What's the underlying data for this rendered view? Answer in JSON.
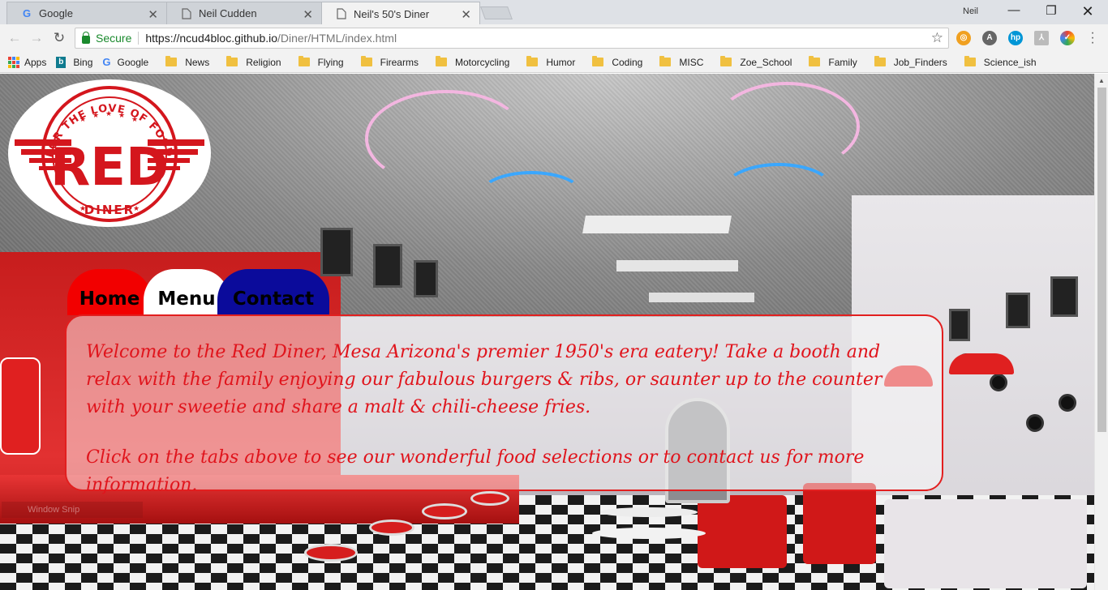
{
  "browser": {
    "tabs": [
      {
        "title": "Google",
        "favicon": "google-g-icon"
      },
      {
        "title": "Neil Cudden",
        "favicon": "document-icon"
      },
      {
        "title": "Neil's 50's Diner",
        "favicon": "document-icon"
      }
    ],
    "profile_name": "Neil",
    "address": {
      "secure_label": "Secure",
      "url_host": "https://ncud4bloc.github.io",
      "url_path": "/Diner/HTML/index.html"
    },
    "bookmarks": [
      {
        "label": "Apps",
        "icon": "apps-grid-icon"
      },
      {
        "label": "Bing",
        "icon": "bing-icon"
      },
      {
        "label": "Google",
        "icon": "google-g-icon"
      },
      {
        "label": "News",
        "icon": "folder-icon"
      },
      {
        "label": "Religion",
        "icon": "folder-icon"
      },
      {
        "label": "Flying",
        "icon": "folder-icon"
      },
      {
        "label": "Firearms",
        "icon": "folder-icon"
      },
      {
        "label": "Motorcycling",
        "icon": "folder-icon"
      },
      {
        "label": "Humor",
        "icon": "folder-icon"
      },
      {
        "label": "Coding",
        "icon": "folder-icon"
      },
      {
        "label": "MISC",
        "icon": "folder-icon"
      },
      {
        "label": "Zoe_School",
        "icon": "folder-icon"
      },
      {
        "label": "Family",
        "icon": "folder-icon"
      },
      {
        "label": "Job_Finders",
        "icon": "folder-icon"
      },
      {
        "label": "Science_ish",
        "icon": "folder-icon"
      }
    ]
  },
  "site": {
    "logo": {
      "arc_text": "FOR THE LOVE OF FOOD",
      "brand": "RED",
      "bottom_text": "DINER"
    },
    "nav": {
      "home": "Home",
      "menu": "Menu",
      "contact": "Contact"
    },
    "welcome": {
      "paragraph1": "Welcome to the Red Diner, Mesa Arizona's premier 1950's era eatery! Take a booth and relax with the family enjoying our fabulous burgers & ribs, or saunter up to the counter with your sweetie and share a malt & chili-cheese fries.",
      "paragraph2": "Click on the tabs above to see our wonderful food selections or to contact us for more information."
    },
    "overlay": {
      "snip_label": "Window Snip"
    }
  },
  "colors": {
    "brand_red": "#e0141c",
    "home_tab": "#f20000",
    "menu_tab": "#ffffff",
    "contact_tab": "#0b0b9b"
  }
}
